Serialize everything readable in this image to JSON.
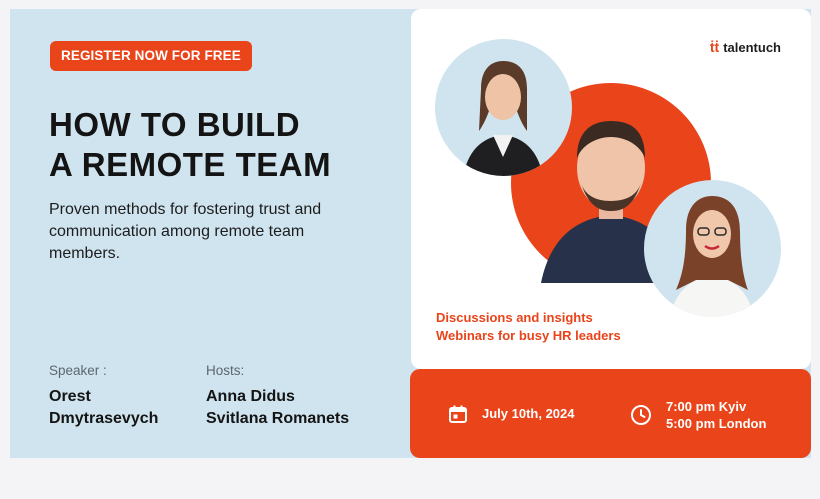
{
  "banner": {
    "register_label": "REGISTER NOW FOR FREE",
    "title_line1": "HOW TO BUILD",
    "title_line2": "A REMOTE TEAM",
    "subtitle": "Proven methods for fostering trust and communication among remote team members.",
    "speaker": {
      "label": "Speaker :",
      "name_line1": "Orest",
      "name_line2": "Dmytrasevych"
    },
    "hosts": {
      "label": "Hosts:",
      "name_line1": "Anna Didus",
      "name_line2": "Svitlana Romanets"
    }
  },
  "card": {
    "logo_text": "talentuch",
    "logo_icon": "tt-logo-mark",
    "tagline_line1": "Discussions and insights",
    "tagline_line2": "Webinars for busy HR leaders"
  },
  "event": {
    "date": "July 10th, 2024",
    "time_line1": "7:00 pm Kyiv",
    "time_line2": "5:00 pm London",
    "date_icon": "calendar-icon",
    "time_icon": "clock-icon"
  },
  "colors": {
    "accent": "#e9441a",
    "banner_bg": "#cfe4ef",
    "text_dark": "#141414"
  }
}
